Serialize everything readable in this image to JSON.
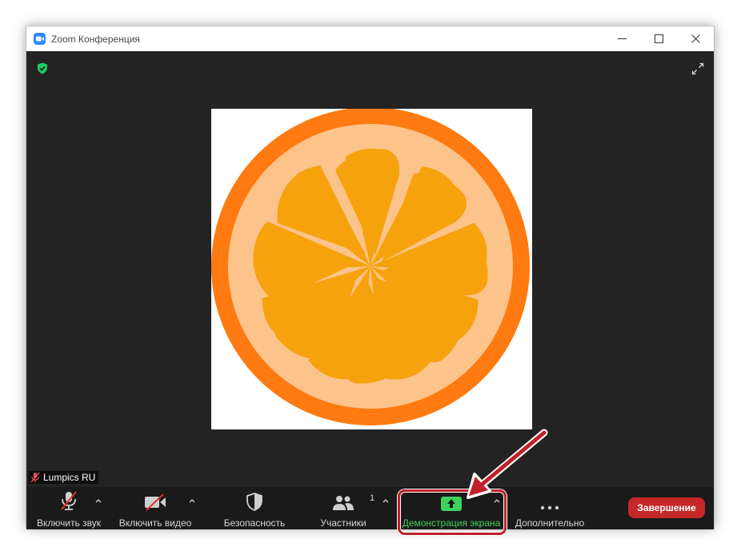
{
  "window": {
    "title": "Zoom Конференция"
  },
  "participant": {
    "name": "Lumpics RU"
  },
  "toolbar": {
    "audio_label": "Включить звук",
    "video_label": "Включить видео",
    "security_label": "Безопасность",
    "participants_label": "Участники",
    "participants_count": "1",
    "share_label": "Демонстрация экрана",
    "more_label": "Дополнительно",
    "end_label": "Завершение"
  },
  "colors": {
    "share_accent": "#3fd15b",
    "end_button": "#c62828",
    "highlight": "#c0202a"
  },
  "icons": {
    "app": "zoom-camera-icon",
    "security_badge": "green-shield-icon",
    "fullscreen": "fullscreen-icon",
    "audio": "muted-microphone-icon",
    "video": "crossed-video-icon",
    "security": "shield-icon",
    "participants": "people-icon",
    "share": "share-screen-arrow-icon",
    "more": "ellipsis-icon"
  }
}
